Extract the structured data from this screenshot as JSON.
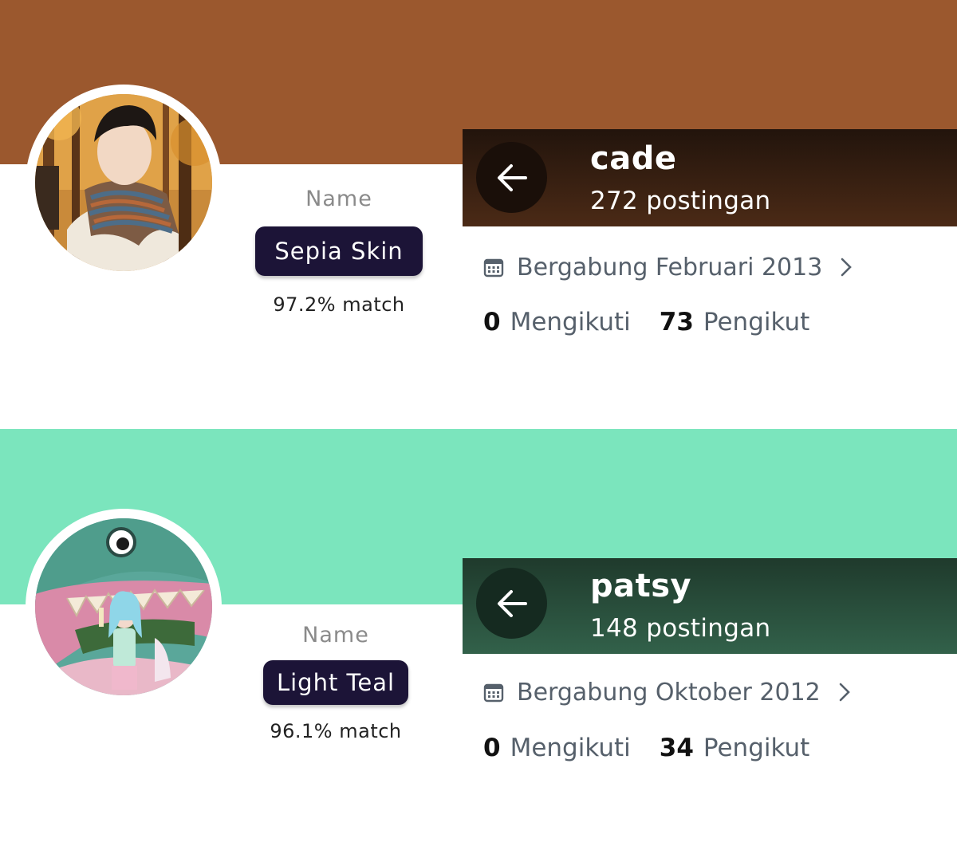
{
  "profiles": [
    {
      "banner_color": "#9b582e",
      "name_caption": "Name",
      "color_name": "Sepia Skin",
      "match": "97.2% match",
      "header_color_top": "#22140c",
      "header_color_bottom": "#4b2a16",
      "back_icon": "arrow-left-icon",
      "handle": "cade",
      "posts": "272 postingan",
      "calendar_icon": "calendar-icon",
      "joined": "Bergabung Februari 2013",
      "following_count": "0",
      "following_label": "Mengikuti",
      "followers_count": "73",
      "followers_label": "Pengikut"
    },
    {
      "banner_color": "#7be5bd",
      "name_caption": "Name",
      "color_name": "Light Teal",
      "match": "96.1% match",
      "header_color_top": "#1f3a2c",
      "header_color_bottom": "#32614a",
      "back_icon": "arrow-left-icon",
      "handle": "patsy",
      "posts": "148 postingan",
      "calendar_icon": "calendar-icon",
      "joined": "Bergabung Oktober 2012",
      "following_count": "0",
      "following_label": "Mengikuti",
      "followers_count": "34",
      "followers_label": "Pengikut"
    }
  ]
}
